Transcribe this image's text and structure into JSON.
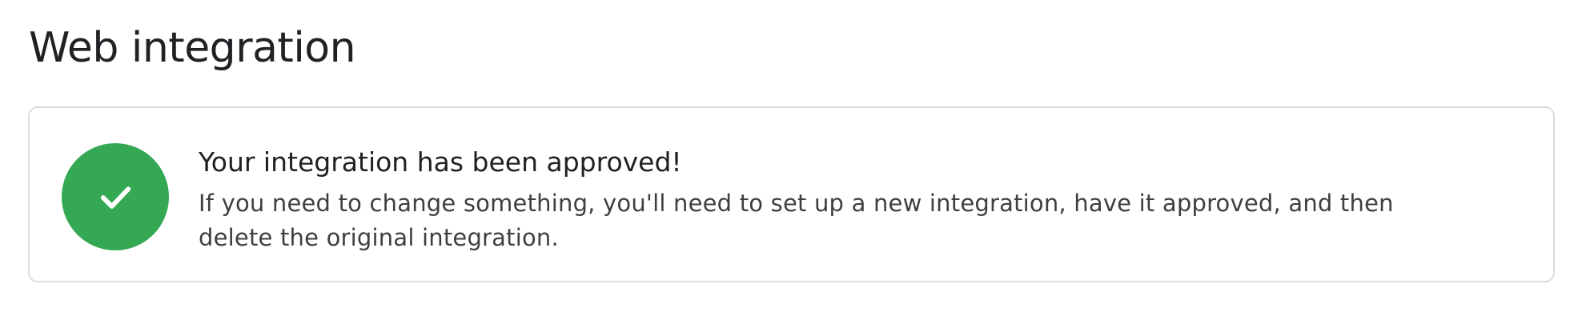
{
  "page": {
    "title": "Web integration"
  },
  "status_card": {
    "icon": "check-icon",
    "accent_color": "#34a853",
    "heading": "Your integration has been approved!",
    "body": "If you need to change something, you'll need to set up a new integration, have it approved, and then delete the original integration."
  }
}
